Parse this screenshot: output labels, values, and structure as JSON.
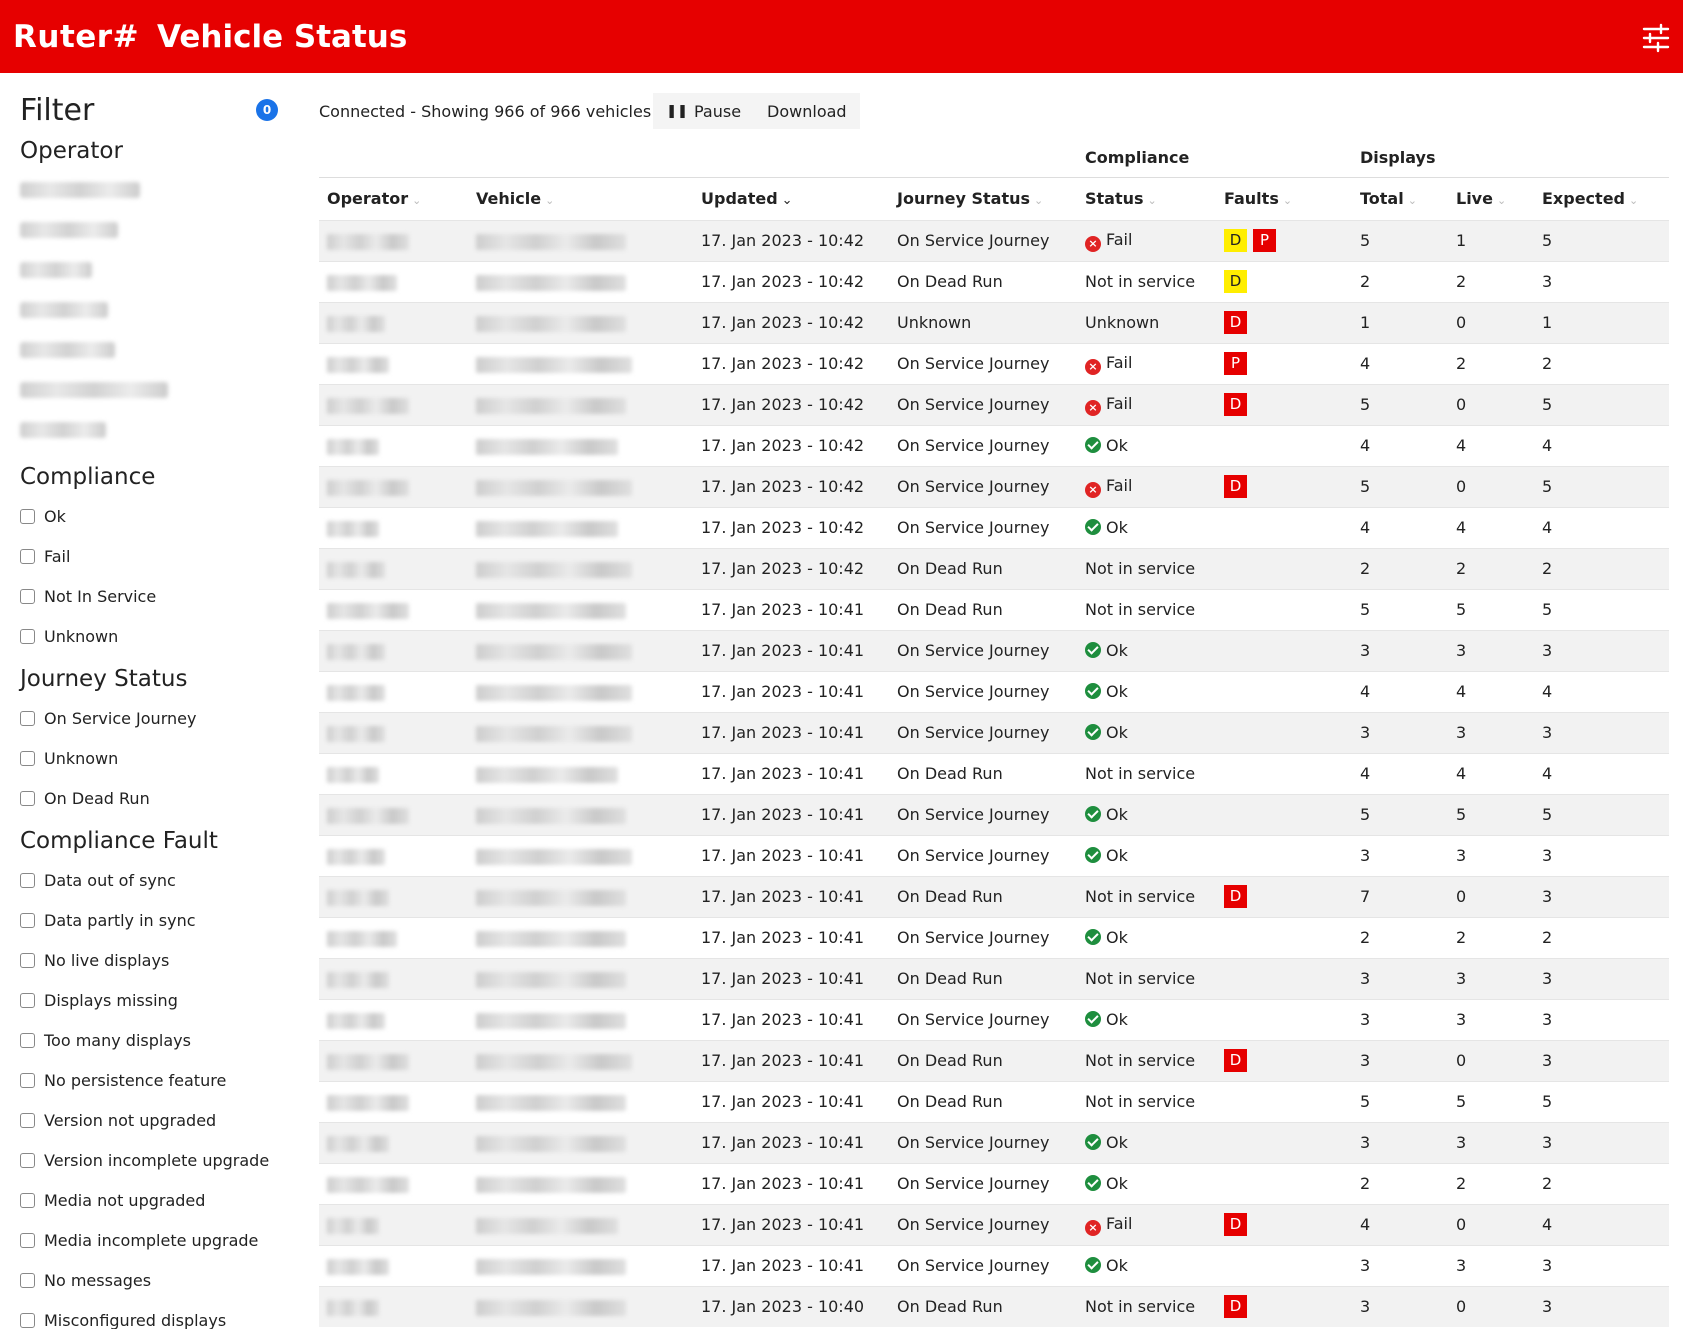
{
  "header": {
    "brand": "Ruter#",
    "title": "Vehicle Status"
  },
  "sidebar": {
    "filter_title": "Filter",
    "filter_count": "0",
    "operator_title": "Operator",
    "operator_items": [
      120,
      98,
      72,
      88,
      95,
      148,
      86
    ],
    "compliance_title": "Compliance",
    "compliance_items": [
      "Ok",
      "Fail",
      "Not In Service",
      "Unknown"
    ],
    "journey_title": "Journey Status",
    "journey_items": [
      "On Service Journey",
      "Unknown",
      "On Dead Run"
    ],
    "fault_title": "Compliance Fault",
    "fault_items": [
      "Data out of sync",
      "Data partly in sync",
      "No live displays",
      "Displays missing",
      "Too many displays",
      "No persistence feature",
      "Version not upgraded",
      "Version incomplete upgrade",
      "Media not upgraded",
      "Media incomplete upgrade",
      "No messages",
      "Misconfigured displays"
    ]
  },
  "toolbar": {
    "status_text": "Connected - Showing 966 of 966 vehicles",
    "pause_label": "Pause",
    "download_label": "Download"
  },
  "table": {
    "group_compliance": "Compliance",
    "group_displays": "Displays",
    "col_operator": "Operator",
    "col_vehicle": "Vehicle",
    "col_updated": "Updated",
    "col_journey": "Journey Status",
    "col_status": "Status",
    "col_faults": "Faults",
    "col_total": "Total",
    "col_live": "Live",
    "col_expected": "Expected",
    "rows": [
      {
        "op": 82,
        "veh": 150,
        "updated": "17. Jan 2023 - 10:42",
        "journey": "On Service Journey",
        "status": "Fail",
        "faults": [
          "D-yellow",
          "P"
        ],
        "total": "5",
        "live": "1",
        "expected": "5"
      },
      {
        "op": 70,
        "veh": 150,
        "updated": "17. Jan 2023 - 10:42",
        "journey": "On Dead Run",
        "status": "Not in service",
        "faults": [
          "D-yellow"
        ],
        "total": "2",
        "live": "2",
        "expected": "3"
      },
      {
        "op": 58,
        "veh": 150,
        "updated": "17. Jan 2023 - 10:42",
        "journey": "Unknown",
        "status": "Unknown",
        "faults": [
          "D"
        ],
        "total": "1",
        "live": "0",
        "expected": "1"
      },
      {
        "op": 62,
        "veh": 156,
        "updated": "17. Jan 2023 - 10:42",
        "journey": "On Service Journey",
        "status": "Fail",
        "faults": [
          "P"
        ],
        "total": "4",
        "live": "2",
        "expected": "2"
      },
      {
        "op": 82,
        "veh": 150,
        "updated": "17. Jan 2023 - 10:42",
        "journey": "On Service Journey",
        "status": "Fail",
        "faults": [
          "D"
        ],
        "total": "5",
        "live": "0",
        "expected": "5"
      },
      {
        "op": 52,
        "veh": 142,
        "updated": "17. Jan 2023 - 10:42",
        "journey": "On Service Journey",
        "status": "Ok",
        "faults": [],
        "total": "4",
        "live": "4",
        "expected": "4"
      },
      {
        "op": 82,
        "veh": 156,
        "updated": "17. Jan 2023 - 10:42",
        "journey": "On Service Journey",
        "status": "Fail",
        "faults": [
          "D"
        ],
        "total": "5",
        "live": "0",
        "expected": "5"
      },
      {
        "op": 52,
        "veh": 142,
        "updated": "17. Jan 2023 - 10:42",
        "journey": "On Service Journey",
        "status": "Ok",
        "faults": [],
        "total": "4",
        "live": "4",
        "expected": "4"
      },
      {
        "op": 58,
        "veh": 156,
        "updated": "17. Jan 2023 - 10:42",
        "journey": "On Dead Run",
        "status": "Not in service",
        "faults": [],
        "total": "2",
        "live": "2",
        "expected": "2"
      },
      {
        "op": 82,
        "veh": 150,
        "updated": "17. Jan 2023 - 10:41",
        "journey": "On Dead Run",
        "status": "Not in service",
        "faults": [],
        "total": "5",
        "live": "5",
        "expected": "5"
      },
      {
        "op": 58,
        "veh": 156,
        "updated": "17. Jan 2023 - 10:41",
        "journey": "On Service Journey",
        "status": "Ok",
        "faults": [],
        "total": "3",
        "live": "3",
        "expected": "3"
      },
      {
        "op": 58,
        "veh": 156,
        "updated": "17. Jan 2023 - 10:41",
        "journey": "On Service Journey",
        "status": "Ok",
        "faults": [],
        "total": "4",
        "live": "4",
        "expected": "4"
      },
      {
        "op": 58,
        "veh": 156,
        "updated": "17. Jan 2023 - 10:41",
        "journey": "On Service Journey",
        "status": "Ok",
        "faults": [],
        "total": "3",
        "live": "3",
        "expected": "3"
      },
      {
        "op": 52,
        "veh": 142,
        "updated": "17. Jan 2023 - 10:41",
        "journey": "On Dead Run",
        "status": "Not in service",
        "faults": [],
        "total": "4",
        "live": "4",
        "expected": "4"
      },
      {
        "op": 82,
        "veh": 150,
        "updated": "17. Jan 2023 - 10:41",
        "journey": "On Service Journey",
        "status": "Ok",
        "faults": [],
        "total": "5",
        "live": "5",
        "expected": "5"
      },
      {
        "op": 58,
        "veh": 156,
        "updated": "17. Jan 2023 - 10:41",
        "journey": "On Service Journey",
        "status": "Ok",
        "faults": [],
        "total": "3",
        "live": "3",
        "expected": "3"
      },
      {
        "op": 62,
        "veh": 150,
        "updated": "17. Jan 2023 - 10:41",
        "journey": "On Dead Run",
        "status": "Not in service",
        "faults": [
          "D"
        ],
        "total": "7",
        "live": "0",
        "expected": "3"
      },
      {
        "op": 70,
        "veh": 150,
        "updated": "17. Jan 2023 - 10:41",
        "journey": "On Service Journey",
        "status": "Ok",
        "faults": [],
        "total": "2",
        "live": "2",
        "expected": "2"
      },
      {
        "op": 62,
        "veh": 150,
        "updated": "17. Jan 2023 - 10:41",
        "journey": "On Dead Run",
        "status": "Not in service",
        "faults": [],
        "total": "3",
        "live": "3",
        "expected": "3"
      },
      {
        "op": 58,
        "veh": 150,
        "updated": "17. Jan 2023 - 10:41",
        "journey": "On Service Journey",
        "status": "Ok",
        "faults": [],
        "total": "3",
        "live": "3",
        "expected": "3"
      },
      {
        "op": 82,
        "veh": 156,
        "updated": "17. Jan 2023 - 10:41",
        "journey": "On Dead Run",
        "status": "Not in service",
        "faults": [
          "D"
        ],
        "total": "3",
        "live": "0",
        "expected": "3"
      },
      {
        "op": 82,
        "veh": 150,
        "updated": "17. Jan 2023 - 10:41",
        "journey": "On Dead Run",
        "status": "Not in service",
        "faults": [],
        "total": "5",
        "live": "5",
        "expected": "5"
      },
      {
        "op": 62,
        "veh": 150,
        "updated": "17. Jan 2023 - 10:41",
        "journey": "On Service Journey",
        "status": "Ok",
        "faults": [],
        "total": "3",
        "live": "3",
        "expected": "3"
      },
      {
        "op": 82,
        "veh": 150,
        "updated": "17. Jan 2023 - 10:41",
        "journey": "On Service Journey",
        "status": "Ok",
        "faults": [],
        "total": "2",
        "live": "2",
        "expected": "2"
      },
      {
        "op": 52,
        "veh": 142,
        "updated": "17. Jan 2023 - 10:41",
        "journey": "On Service Journey",
        "status": "Fail",
        "faults": [
          "D"
        ],
        "total": "4",
        "live": "0",
        "expected": "4"
      },
      {
        "op": 62,
        "veh": 150,
        "updated": "17. Jan 2023 - 10:41",
        "journey": "On Service Journey",
        "status": "Ok",
        "faults": [],
        "total": "3",
        "live": "3",
        "expected": "3"
      },
      {
        "op": 52,
        "veh": 150,
        "updated": "17. Jan 2023 - 10:40",
        "journey": "On Dead Run",
        "status": "Not in service",
        "faults": [
          "D"
        ],
        "total": "3",
        "live": "0",
        "expected": "3"
      }
    ]
  },
  "colors": {
    "brand_red": "#e60000",
    "ok_green": "#1e8e3e",
    "fail_red": "#e02424",
    "fault_yellow": "#ffee00",
    "badge_blue": "#1a73e8"
  }
}
